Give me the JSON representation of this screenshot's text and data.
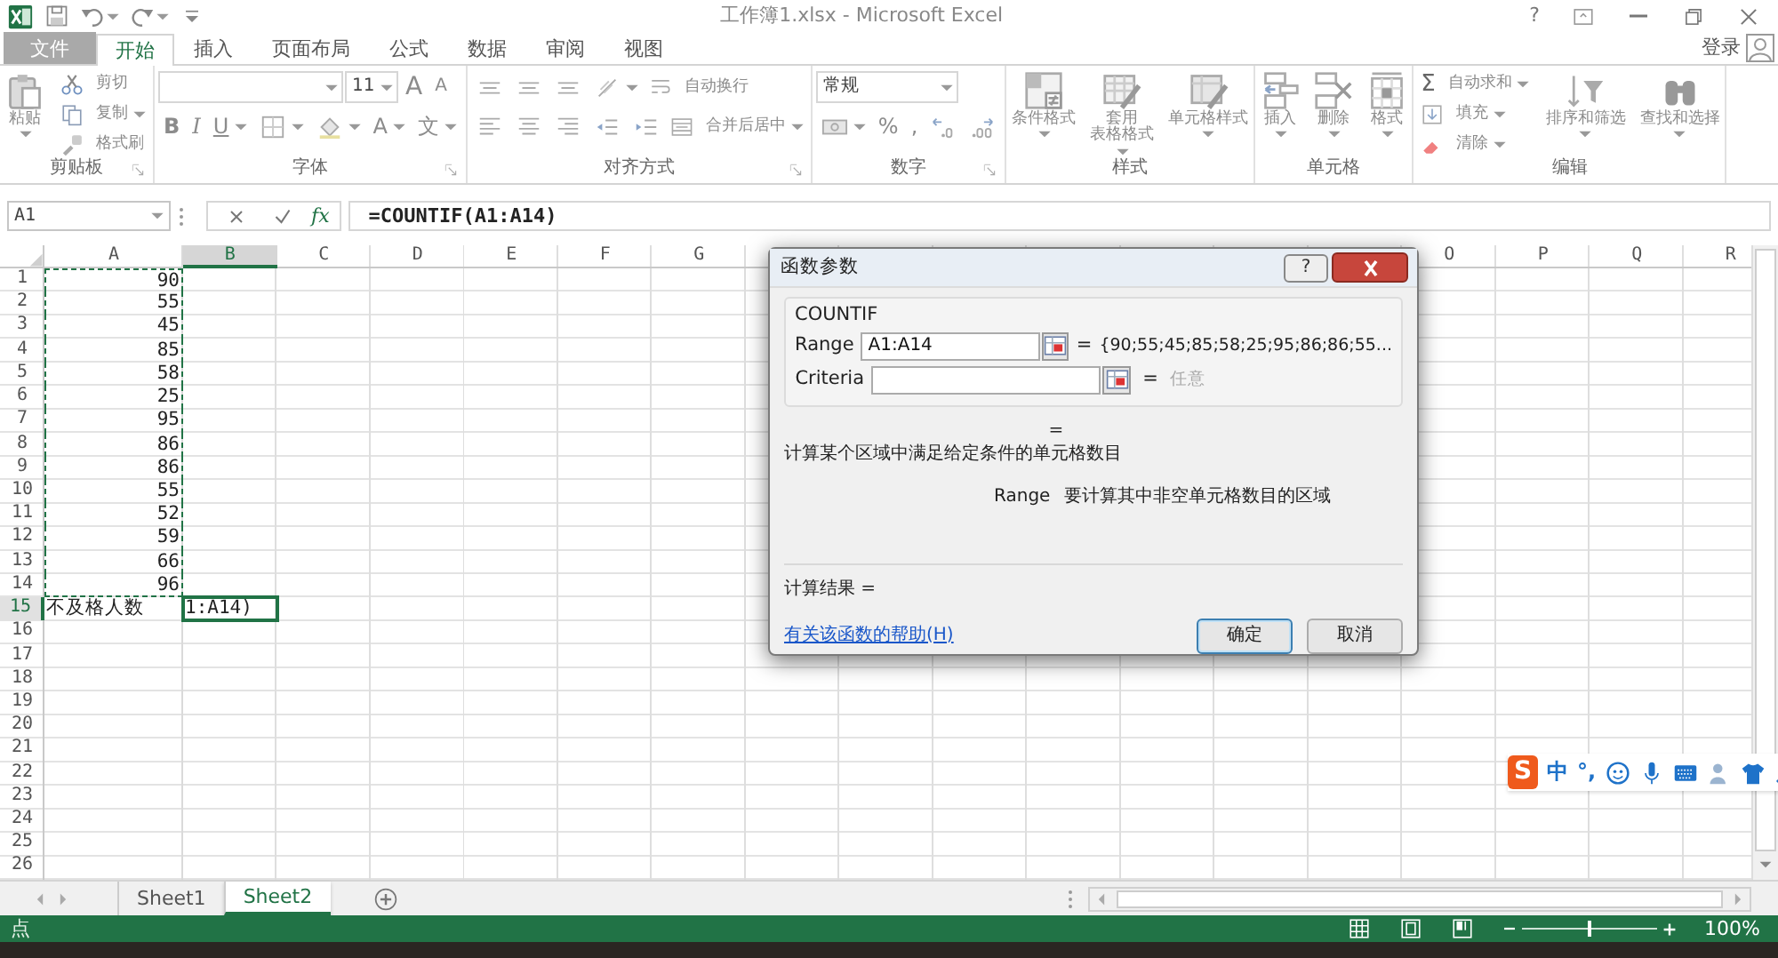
{
  "title_bar": {
    "quick_access": [
      {
        "dropdown": false
      },
      {
        "dropdown": true
      },
      {
        "dropdown": true
      },
      {
        "dropdown": false
      }
    ],
    "title": "工作簿1.xlsx - Microsoft Excel",
    "window_buttons": [
      {
        "kind": "text",
        "text": "?"
      },
      {
        "kind": "icon"
      },
      {
        "kind": "icon"
      },
      {
        "kind": "icon"
      },
      {
        "kind": "icon"
      }
    ]
  },
  "tabs": [
    {
      "label": "文件",
      "kind": "file",
      "selected": false
    },
    {
      "label": "开始",
      "kind": "tab",
      "selected": true
    },
    {
      "label": "插入",
      "kind": "tab",
      "selected": false
    },
    {
      "label": "页面布局",
      "kind": "tab",
      "selected": false
    },
    {
      "label": "公式",
      "kind": "tab",
      "selected": false
    },
    {
      "label": "数据",
      "kind": "tab",
      "selected": false
    },
    {
      "label": "审阅",
      "kind": "tab",
      "selected": false
    },
    {
      "label": "视图",
      "kind": "tab",
      "selected": false
    }
  ],
  "account": {
    "label": "登录"
  },
  "ribbon": {
    "groups": [
      {
        "title": "剪贴板",
        "launcher": true,
        "stacks": [
          [
            {
              "kind": "large",
              "label": [
                "粘贴"
              ],
              "dropdown": true
            }
          ],
          [
            {
              "kind": "small",
              "label": "剪切",
              "dropdown": false
            },
            {
              "kind": "small",
              "label": "复制",
              "dropdown": true
            },
            {
              "kind": "small",
              "label": "格式刷",
              "dropdown": false
            }
          ]
        ]
      },
      {
        "title": "字体",
        "launcher": true,
        "strips": [
          [
            {
              "kind": "font-field",
              "dropdown": true
            },
            {
              "kind": "size-field",
              "value": "11",
              "dropdown": true
            },
            {
              "kind": "glyph-large",
              "text": "A",
              "dropdown": false
            },
            {
              "kind": "glyph-small",
              "text": "A",
              "dropdown": false
            }
          ],
          [
            {
              "kind": "bold",
              "text": "B",
              "dropdown": false
            },
            {
              "kind": "italic",
              "text": "I",
              "dropdown": false
            },
            {
              "kind": "underline",
              "text": "U",
              "dropdown": true
            },
            {
              "kind": "icon",
              "dropdown": true
            },
            {
              "kind": "icon",
              "dropdown": true
            },
            {
              "kind": "glyph",
              "text": "A",
              "dropdown": true
            },
            {
              "kind": "glyph",
              "text": "文",
              "dropdown": true
            }
          ]
        ]
      },
      {
        "title": "对齐方式",
        "launcher": true,
        "strips": [
          [
            {
              "kind": "icon",
              "dropdown": false
            },
            {
              "kind": "icon",
              "dropdown": false
            },
            {
              "kind": "icon",
              "dropdown": false
            },
            {
              "kind": "icon",
              "dropdown": true
            },
            {
              "kind": "small",
              "label": "自动换行",
              "dropdown": false
            }
          ],
          [
            {
              "kind": "icon",
              "dropdown": false
            },
            {
              "kind": "icon",
              "dropdown": false
            },
            {
              "kind": "icon",
              "dropdown": false
            },
            {
              "kind": "icon",
              "dropdown": false
            },
            {
              "kind": "icon",
              "dropdown": false
            },
            {
              "kind": "small",
              "label": "合并后居中",
              "dropdown": true
            }
          ]
        ]
      },
      {
        "title": "数字",
        "launcher": true,
        "strips": [
          [
            {
              "kind": "format-field",
              "value": "常规",
              "dropdown": true
            }
          ],
          [
            {
              "kind": "icon",
              "dropdown": true
            },
            {
              "kind": "glyph",
              "text": "%",
              "dropdown": false
            },
            {
              "kind": "glyph",
              "text": ",",
              "dropdown": false
            },
            {
              "kind": "icon",
              "dropdown": false
            },
            {
              "kind": "icon",
              "dropdown": false
            }
          ]
        ]
      },
      {
        "title": "样式",
        "launcher": false,
        "stacks": [
          [
            {
              "kind": "large",
              "label": [
                "条件格式"
              ],
              "dropdown": true
            }
          ],
          [
            {
              "kind": "large",
              "label": [
                "套用",
                "表格格式"
              ],
              "dropdown": true
            }
          ],
          [
            {
              "kind": "large",
              "label": [
                "单元格样式"
              ],
              "dropdown": true
            }
          ]
        ]
      },
      {
        "title": "单元格",
        "launcher": false,
        "stacks": [
          [
            {
              "kind": "large",
              "label": [
                "插入"
              ],
              "dropdown": true
            }
          ],
          [
            {
              "kind": "large",
              "label": [
                "删除"
              ],
              "dropdown": true
            }
          ],
          [
            {
              "kind": "large",
              "label": [
                "格式"
              ],
              "dropdown": true
            }
          ]
        ]
      },
      {
        "title": "编辑",
        "launcher": false,
        "stacks": [
          [
            {
              "kind": "small",
              "glyph": "Σ",
              "label": "自动求和",
              "dropdown": true
            },
            {
              "kind": "small",
              "label": "填充",
              "dropdown": true
            },
            {
              "kind": "small",
              "label": "清除",
              "dropdown": true
            }
          ],
          [
            {
              "kind": "large",
              "label": [
                "排序和筛选"
              ],
              "dropdown": true
            }
          ],
          [
            {
              "kind": "large",
              "label": [
                "查找和选择"
              ],
              "dropdown": true
            }
          ]
        ]
      }
    ]
  },
  "formula_bar": {
    "name_box": "A1",
    "fx": "fx",
    "formula": "=COUNTIF(A1:A14)"
  },
  "sheet": {
    "columns": [
      {
        "label": "A",
        "selected": false
      },
      {
        "label": "B",
        "selected": true
      },
      {
        "label": "C",
        "selected": false
      },
      {
        "label": "D",
        "selected": false
      },
      {
        "label": "E",
        "selected": false
      },
      {
        "label": "F",
        "selected": false
      },
      {
        "label": "G",
        "selected": false
      },
      {
        "label": "O",
        "selected": false
      },
      {
        "label": "P",
        "selected": false
      },
      {
        "label": "Q",
        "selected": false
      },
      {
        "label": "R",
        "selected": false
      }
    ],
    "rows": [
      {
        "number": "1",
        "selected": false,
        "referenced": true,
        "cells": [
          {
            "text": "90",
            "kind": "number"
          }
        ]
      },
      {
        "number": "2",
        "selected": false,
        "referenced": true,
        "cells": [
          {
            "text": "55",
            "kind": "number"
          }
        ]
      },
      {
        "number": "3",
        "selected": false,
        "referenced": true,
        "cells": [
          {
            "text": "45",
            "kind": "number"
          }
        ]
      },
      {
        "number": "4",
        "selected": false,
        "referenced": true,
        "cells": [
          {
            "text": "85",
            "kind": "number"
          }
        ]
      },
      {
        "number": "5",
        "selected": false,
        "referenced": true,
        "cells": [
          {
            "text": "58",
            "kind": "number"
          }
        ]
      },
      {
        "number": "6",
        "selected": false,
        "referenced": true,
        "cells": [
          {
            "text": "25",
            "kind": "number"
          }
        ]
      },
      {
        "number": "7",
        "selected": false,
        "referenced": true,
        "cells": [
          {
            "text": "95",
            "kind": "number"
          }
        ]
      },
      {
        "number": "8",
        "selected": false,
        "referenced": true,
        "cells": [
          {
            "text": "86",
            "kind": "number"
          }
        ]
      },
      {
        "number": "9",
        "selected": false,
        "referenced": true,
        "cells": [
          {
            "text": "86",
            "kind": "number"
          }
        ]
      },
      {
        "number": "10",
        "selected": false,
        "referenced": true,
        "cells": [
          {
            "text": "55",
            "kind": "number"
          }
        ]
      },
      {
        "number": "11",
        "selected": false,
        "referenced": true,
        "cells": [
          {
            "text": "52",
            "kind": "number"
          }
        ]
      },
      {
        "number": "12",
        "selected": false,
        "referenced": true,
        "cells": [
          {
            "text": "59",
            "kind": "number"
          }
        ]
      },
      {
        "number": "13",
        "selected": false,
        "referenced": true,
        "cells": [
          {
            "text": "66",
            "kind": "number"
          }
        ]
      },
      {
        "number": "14",
        "selected": false,
        "referenced": true,
        "cells": [
          {
            "text": "96",
            "kind": "number"
          }
        ]
      },
      {
        "number": "15",
        "selected": true,
        "referenced": false,
        "cells": [
          {
            "text": "不及格人数",
            "kind": "text"
          },
          {
            "text": "1:A14)",
            "kind": "text"
          }
        ]
      },
      {
        "number": "16",
        "selected": false,
        "referenced": false
      },
      {
        "number": "17",
        "selected": false,
        "referenced": false
      },
      {
        "number": "18",
        "selected": false,
        "referenced": false
      },
      {
        "number": "19",
        "selected": false,
        "referenced": false
      },
      {
        "number": "20",
        "selected": false,
        "referenced": false
      },
      {
        "number": "21",
        "selected": false,
        "referenced": false
      },
      {
        "number": "22",
        "selected": false,
        "referenced": false
      },
      {
        "number": "23",
        "selected": false,
        "referenced": false
      },
      {
        "number": "24",
        "selected": false,
        "referenced": false
      },
      {
        "number": "25",
        "selected": false,
        "referenced": false
      },
      {
        "number": "26",
        "selected": false,
        "referenced": false
      }
    ]
  },
  "dialog": {
    "title": "函数参数",
    "help": "?",
    "function_name": "COUNTIF",
    "arguments": [
      {
        "label": "Range",
        "value": "A1:A14",
        "equals": "=",
        "result": "{90;55;45;85;58;25;95;86;86;55...",
        "greyed": false
      },
      {
        "label": "Criteria",
        "equals": "=",
        "result": "任意",
        "greyed": true
      }
    ],
    "formula_equals": "=",
    "description": "计算某个区域中满足给定条件的单元格数目",
    "argument_help": {
      "name": "Range",
      "text": "要计算其中非空单元格数目的区域"
    },
    "result_label": "计算结果 =",
    "help_link": "有关该函数的帮助(H)",
    "buttons": [
      {
        "label": "确定",
        "default": true
      },
      {
        "label": "取消",
        "default": false
      }
    ]
  },
  "sheet_tabs": {
    "tabs": [
      {
        "label": "Sheet1",
        "selected": false
      },
      {
        "label": "Sheet2",
        "selected": true
      }
    ]
  },
  "status_bar": {
    "mode": "点",
    "zoom": {
      "level": 0.5,
      "reading": "100%"
    }
  },
  "ime_toolbar": {
    "logo": "S",
    "items": [
      {
        "kind": "text",
        "text": "中"
      },
      {
        "kind": "text",
        "text": "°,"
      },
      {
        "kind": "icon"
      },
      {
        "kind": "icon"
      },
      {
        "kind": "icon"
      },
      {
        "kind": "icon"
      },
      {
        "kind": "icon"
      },
      {
        "kind": "icon"
      }
    ]
  }
}
